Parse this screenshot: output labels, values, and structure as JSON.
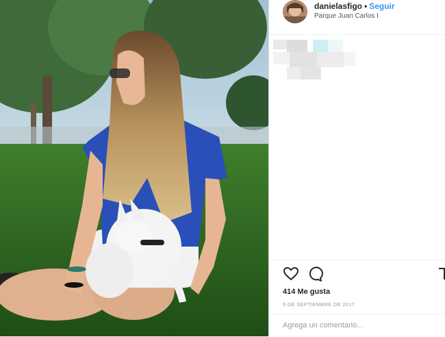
{
  "post": {
    "photo_description": "Young woman with long hair sitting on grass with small white dog",
    "header": {
      "username": "danielasfigo",
      "separator": "•",
      "follow_label": "Seguir",
      "location": "Parque Juan Carlos I"
    },
    "actions": {
      "like_icon": "heart-icon",
      "comment_icon": "comment-icon",
      "save_icon": "bookmark-icon"
    },
    "likes": "414 Me gusta",
    "date": "5 DE SEPTIEMBRE DE 2017",
    "comment": {
      "placeholder": "Agrega un comentario..."
    }
  },
  "colors": {
    "link": "#3897f0",
    "text": "#262626",
    "muted": "#999999",
    "border": "#dbdbdb"
  }
}
